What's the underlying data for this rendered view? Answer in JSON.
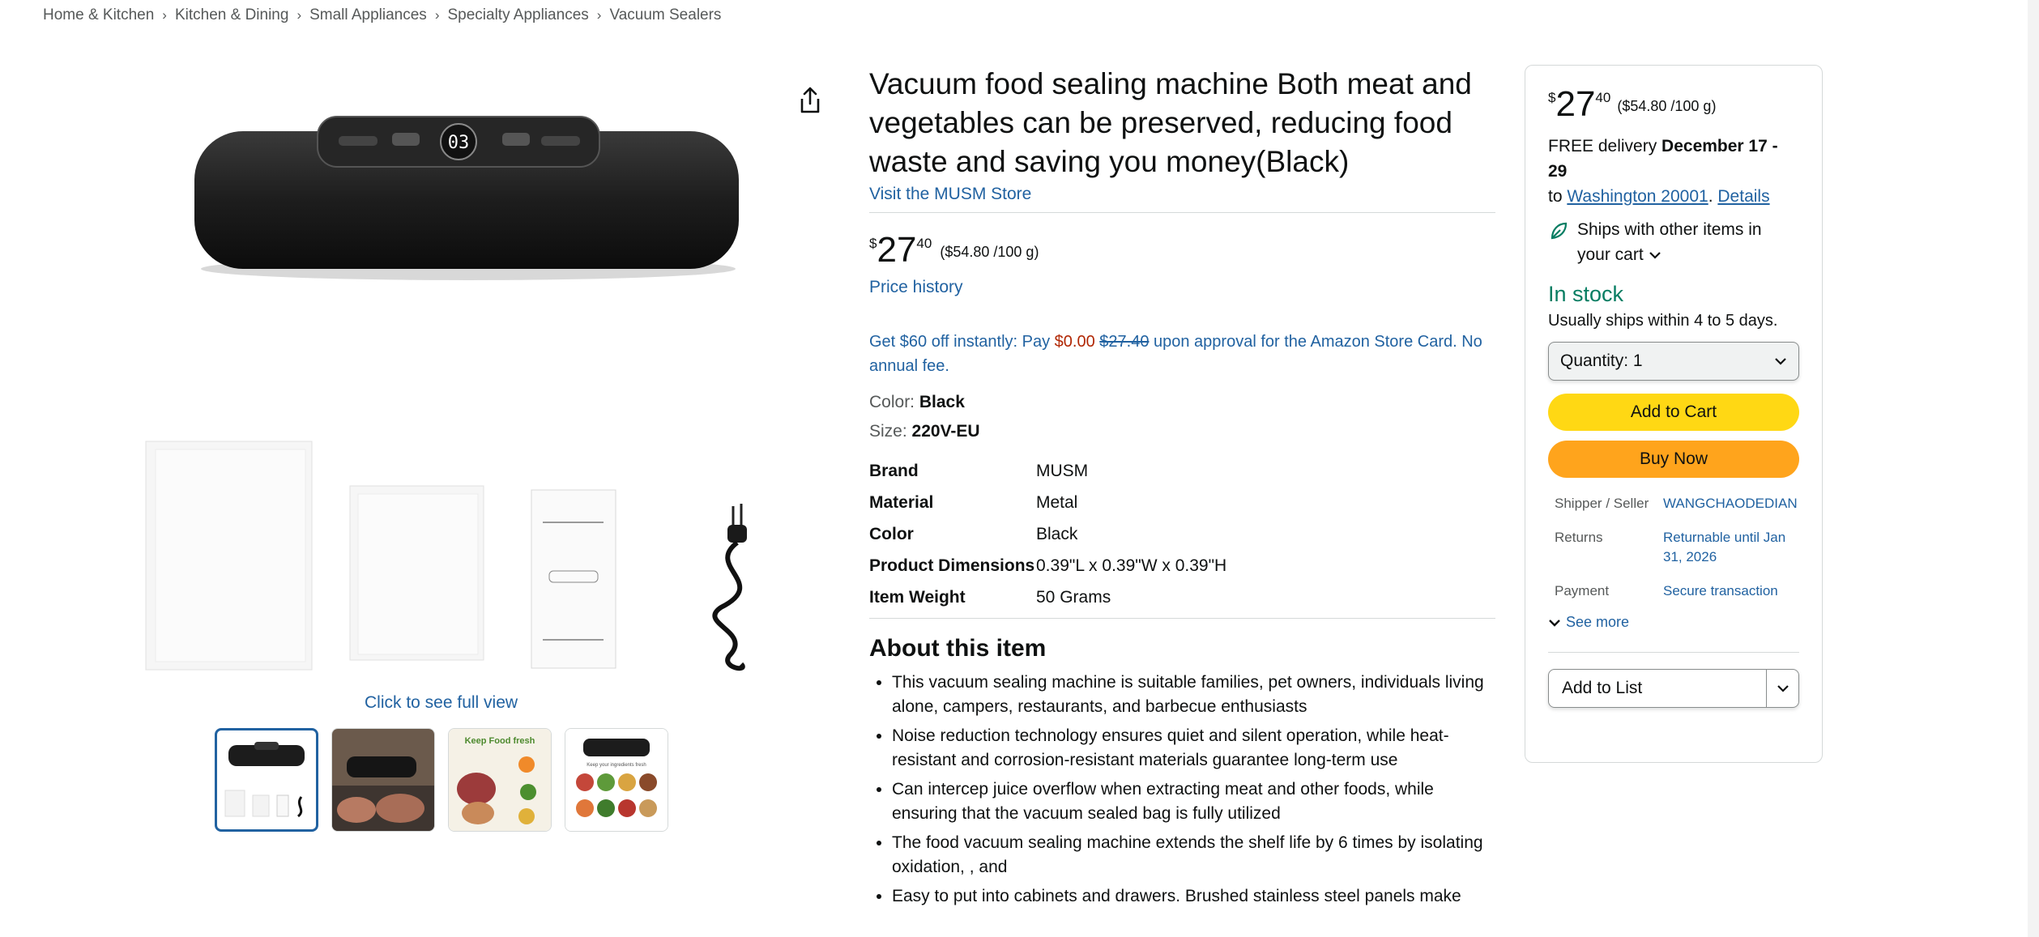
{
  "breadcrumb": [
    "Home & Kitchen",
    "Kitchen & Dining",
    "Small Appliances",
    "Specialty Appliances",
    "Vacuum Sealers"
  ],
  "breadcrumb_separator": "›",
  "gallery": {
    "main_display": "03",
    "full_view_link": "Click to see full view",
    "thumb_3_text": "Keep Food fresh",
    "thumb_4_text": "Keep your ingredients fresh",
    "active_thumb": 1
  },
  "product": {
    "title": "Vacuum food sealing machine Both meat and vegetables can be preserved, reducing food waste and saving you money(Black)",
    "store_link": "Visit the MUSM Store",
    "price": {
      "symbol": "$",
      "whole": "27",
      "fraction": "40",
      "unit": "($54.80 /100 g)"
    },
    "price_history": "Price history",
    "offer": {
      "prefix": "Get $60 off instantly: Pay ",
      "pay": "$0.00",
      "old": "$27.40",
      "suffix": " upon approval for the Amazon Store Card. No annual fee."
    },
    "variations": [
      {
        "label": "Color: ",
        "value": "Black"
      },
      {
        "label": "Size: ",
        "value": "220V-EU"
      }
    ],
    "specs": [
      {
        "key": "Brand",
        "value": "MUSM"
      },
      {
        "key": "Material",
        "value": "Metal"
      },
      {
        "key": "Color",
        "value": "Black"
      },
      {
        "key": "Product Dimensions",
        "value": "0.39\"L x 0.39\"W x 0.39\"H"
      },
      {
        "key": "Item Weight",
        "value": "50 Grams"
      }
    ],
    "about_heading": "About this item",
    "bullets": [
      "This vacuum sealing machine is suitable families, pet owners, individuals living alone, campers, restaurants, and barbecue enthusiasts",
      "Noise reduction technology ensures quiet and silent operation, while heat-resistant and corrosion-resistant materials guarantee long-term use",
      "Can intercep juice overflow when extracting meat and other foods, while ensuring that the vacuum sealed bag is fully utilized",
      "The food vacuum sealing machine extends the shelf life by 6 times by isolating oxidation, , and",
      "Easy to put into cabinets and drawers. Brushed stainless steel panels make"
    ]
  },
  "buybox": {
    "price": {
      "symbol": "$",
      "whole": "27",
      "fraction": "40",
      "unit": "($54.80 /100 g)"
    },
    "delivery_prefix": "FREE delivery ",
    "delivery_dates": "December 17 - 29",
    "delivery_to": "to ",
    "delivery_location": "Washington 20001",
    "delivery_sep": ". ",
    "delivery_details": "Details",
    "ships_with": "Ships with other items in your cart",
    "stock": "In stock",
    "usually": "Usually ships within 4 to 5 days.",
    "quantity_label": "Quantity:",
    "quantity_value": "1",
    "add_to_cart": "Add to Cart",
    "buy_now": "Buy Now",
    "info": [
      {
        "key": "Shipper / Seller",
        "value": "WANGCHAODEDIAN"
      },
      {
        "key": "Returns",
        "value": "Returnable until Jan 31, 2026"
      },
      {
        "key": "Payment",
        "value": "Secure transaction"
      }
    ],
    "see_more": "See more",
    "add_to_list": "Add to List"
  },
  "colors": {
    "link": "#2162a1",
    "cart": "#ffd814",
    "buy": "#ffa41c",
    "stock": "#067d62",
    "deal": "#b12704"
  }
}
